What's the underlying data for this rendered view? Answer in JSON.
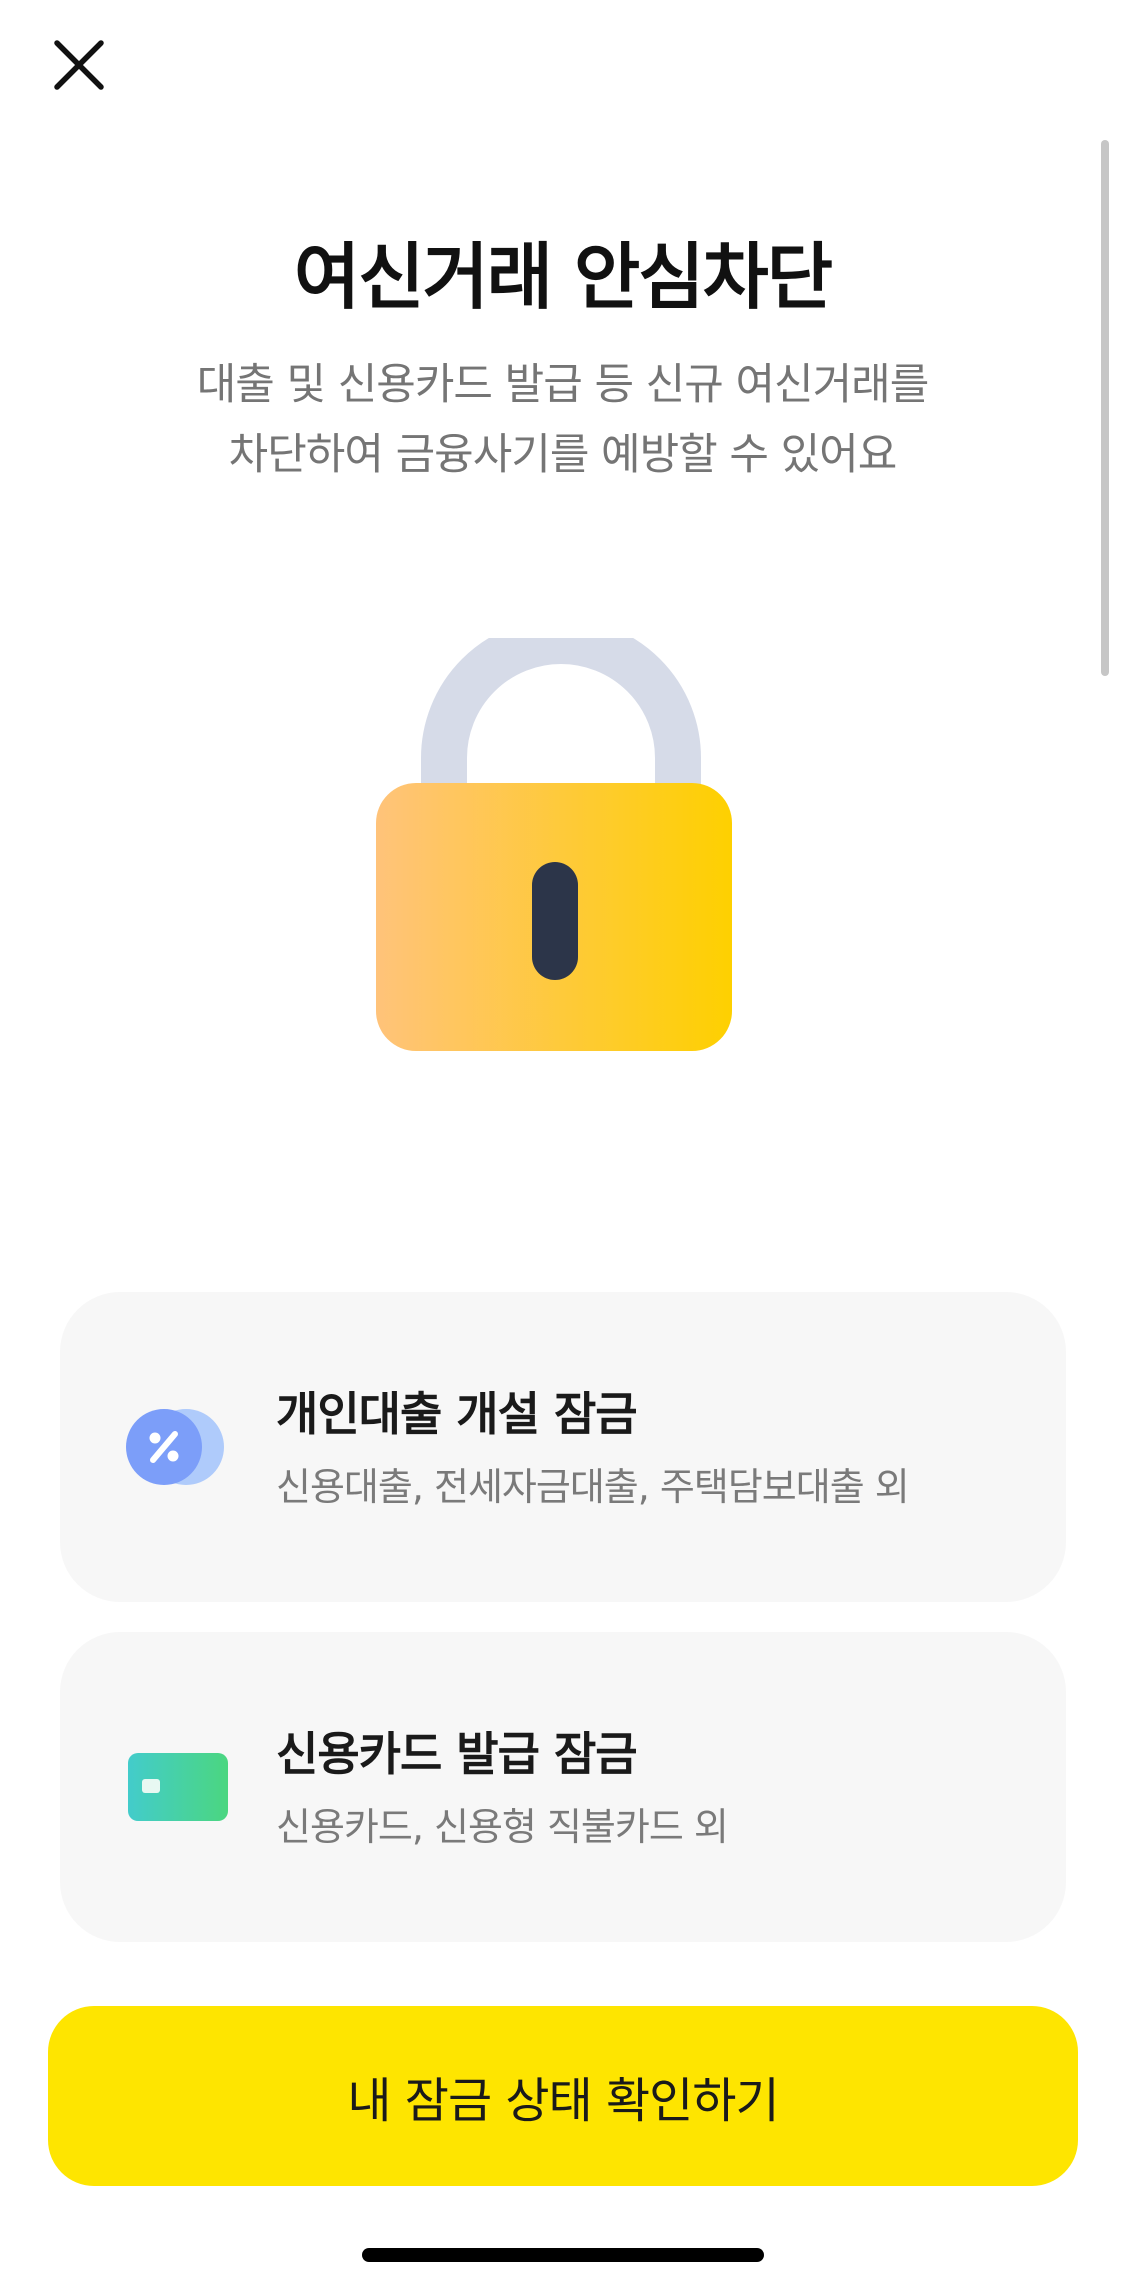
{
  "header": {
    "close_icon": "close-icon"
  },
  "main": {
    "title": "여신거래 안심차단",
    "subtitle_lines": [
      "대출 및 신용카드 발급 등 신규 여신거래를",
      "차단하여 금융사기를 예방할 수 있어요"
    ],
    "illustration": "padlock-icon"
  },
  "options": [
    {
      "icon": "loan-percent-icon",
      "title": "개인대출 개설 잠금",
      "description": "신용대출, 전세자금대출, 주택담보대출 외"
    },
    {
      "icon": "credit-card-icon",
      "title": "신용카드 발급 잠금",
      "description": "신용카드, 신용형 직불카드 외"
    }
  ],
  "footer": {
    "cta_label": "내 잠금 상태 확인하기"
  },
  "colors": {
    "accent": "#FEE500",
    "card_background": "#F7F7F7",
    "subtitle_text": "#757575"
  }
}
